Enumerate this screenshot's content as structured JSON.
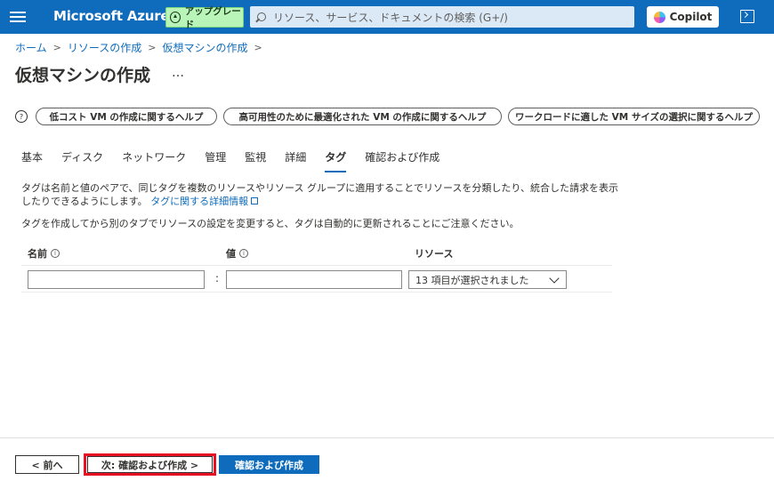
{
  "topbar": {
    "brand": "Microsoft Azure",
    "upgrade_label": "アップグレード",
    "search_placeholder": "リソース、サービス、ドキュメントの検索 (G+/)",
    "copilot_label": "Copilot"
  },
  "breadcrumb": {
    "items": [
      "ホーム",
      "リソースの作成",
      "仮想マシンの作成"
    ]
  },
  "page": {
    "title": "仮想マシンの作成",
    "more": "…"
  },
  "help_buttons": [
    "低コスト VM の作成に関するヘルプ",
    "高可用性のために最適化された VM の作成に関するヘルプ",
    "ワークロードに適した VM サイズの選択に関するヘルプ"
  ],
  "tabs": [
    "基本",
    "ディスク",
    "ネットワーク",
    "管理",
    "監視",
    "詳細",
    "タグ",
    "確認および作成"
  ],
  "active_tab": "タグ",
  "description": {
    "text": "タグは名前と値のペアで、同じタグを複数のリソースやリソース グループに適用することでリソースを分類したり、統合した請求を表示したりできるようにします。",
    "link": "タグに関する詳細情報",
    "note": "タグを作成してから別のタブでリソースの設定を変更すると、タグは自動的に更新されることにご注意ください。"
  },
  "tag_table": {
    "headers": {
      "name": "名前",
      "value": "値",
      "resource": "リソース"
    },
    "info_glyph": "i",
    "separator": ":",
    "row": {
      "name": "",
      "value": "",
      "resource": "13 項目が選択されました"
    }
  },
  "footer": {
    "prev": "< 前へ",
    "next": "次: 確認および作成 >",
    "create": "確認および作成"
  },
  "colors": {
    "header_bg": "#0f6cbd",
    "upgrade_bg": "#b9f5b9",
    "primary_button": "#0f6cbd",
    "highlight_frame": "#e81123"
  }
}
